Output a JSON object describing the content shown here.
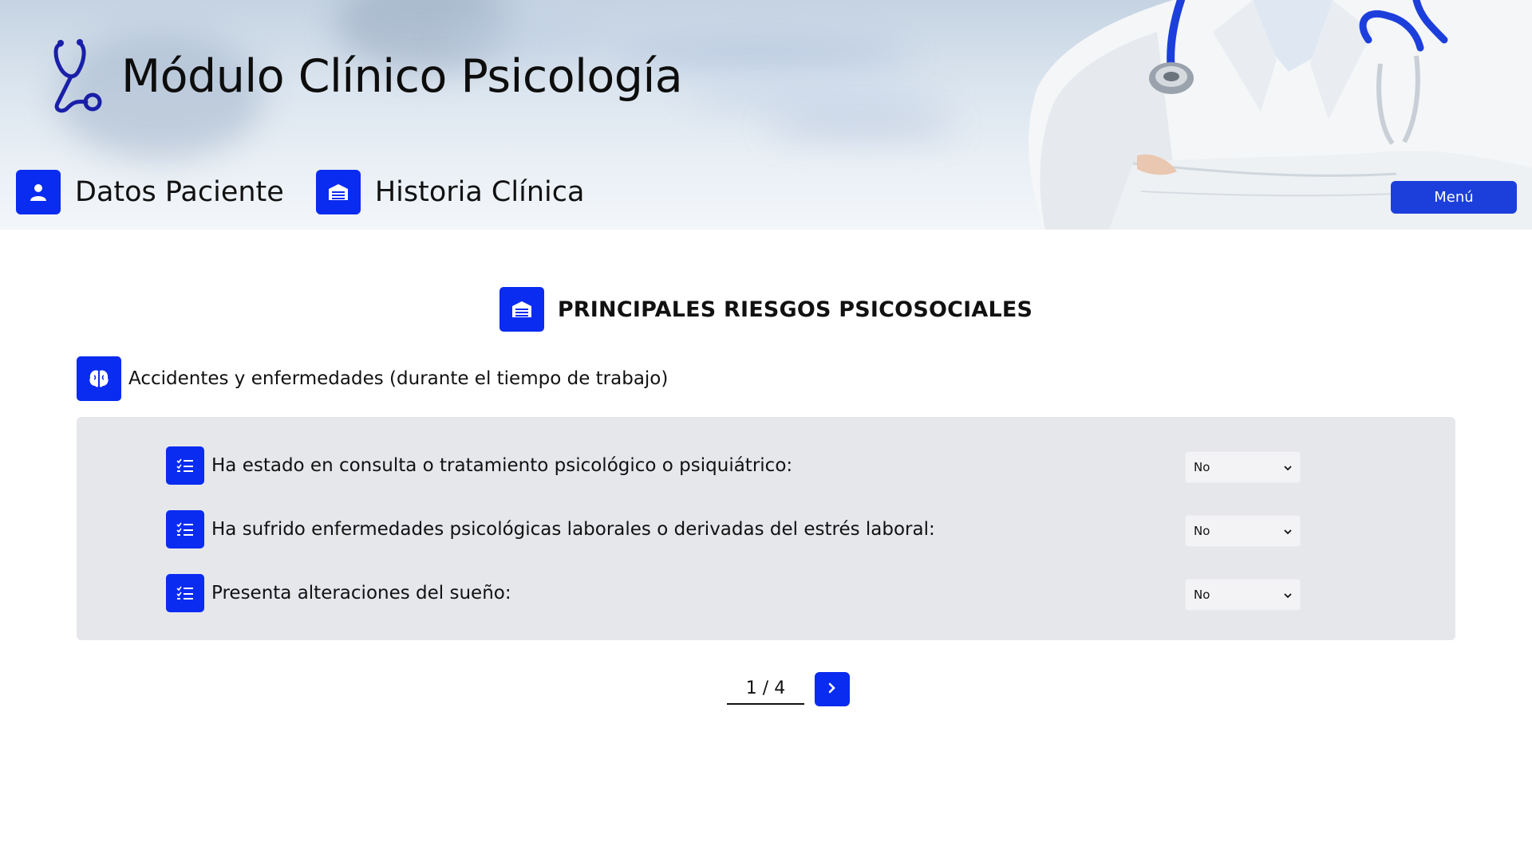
{
  "header": {
    "app_title": "Módulo Clínico Psicología",
    "brand_icon": "stethoscope-icon",
    "nav": [
      {
        "label": "Datos Paciente",
        "icon": "user-icon"
      },
      {
        "label": "Historia Clínica",
        "icon": "archive-icon"
      }
    ],
    "menu_label": "Menú"
  },
  "section": {
    "title": "PRINCIPALES RIESGOS PSICOSOCIALES",
    "icon": "archive-icon",
    "subsection": {
      "title": "Accidentes y enfermedades (durante el tiempo de trabajo)",
      "icon": "brain-icon"
    }
  },
  "questions": [
    {
      "label": "Ha estado en consulta o tratamiento psicológico o psiquiátrico:",
      "value": "No",
      "icon": "checklist-icon"
    },
    {
      "label": "Ha sufrido enfermedades psicológicas laborales o derivadas del estrés laboral:",
      "value": "No",
      "icon": "checklist-icon"
    },
    {
      "label": "Presenta alteraciones del sueño:",
      "value": "No",
      "icon": "checklist-icon"
    }
  ],
  "pager": {
    "current": "1 / 4",
    "next_icon": "chevron-right-icon"
  },
  "colors": {
    "accent": "#0a2bf0",
    "menu_button": "#1c3fdc",
    "panel": "#e6e7eb",
    "brand_icon": "#1a1fa8"
  }
}
